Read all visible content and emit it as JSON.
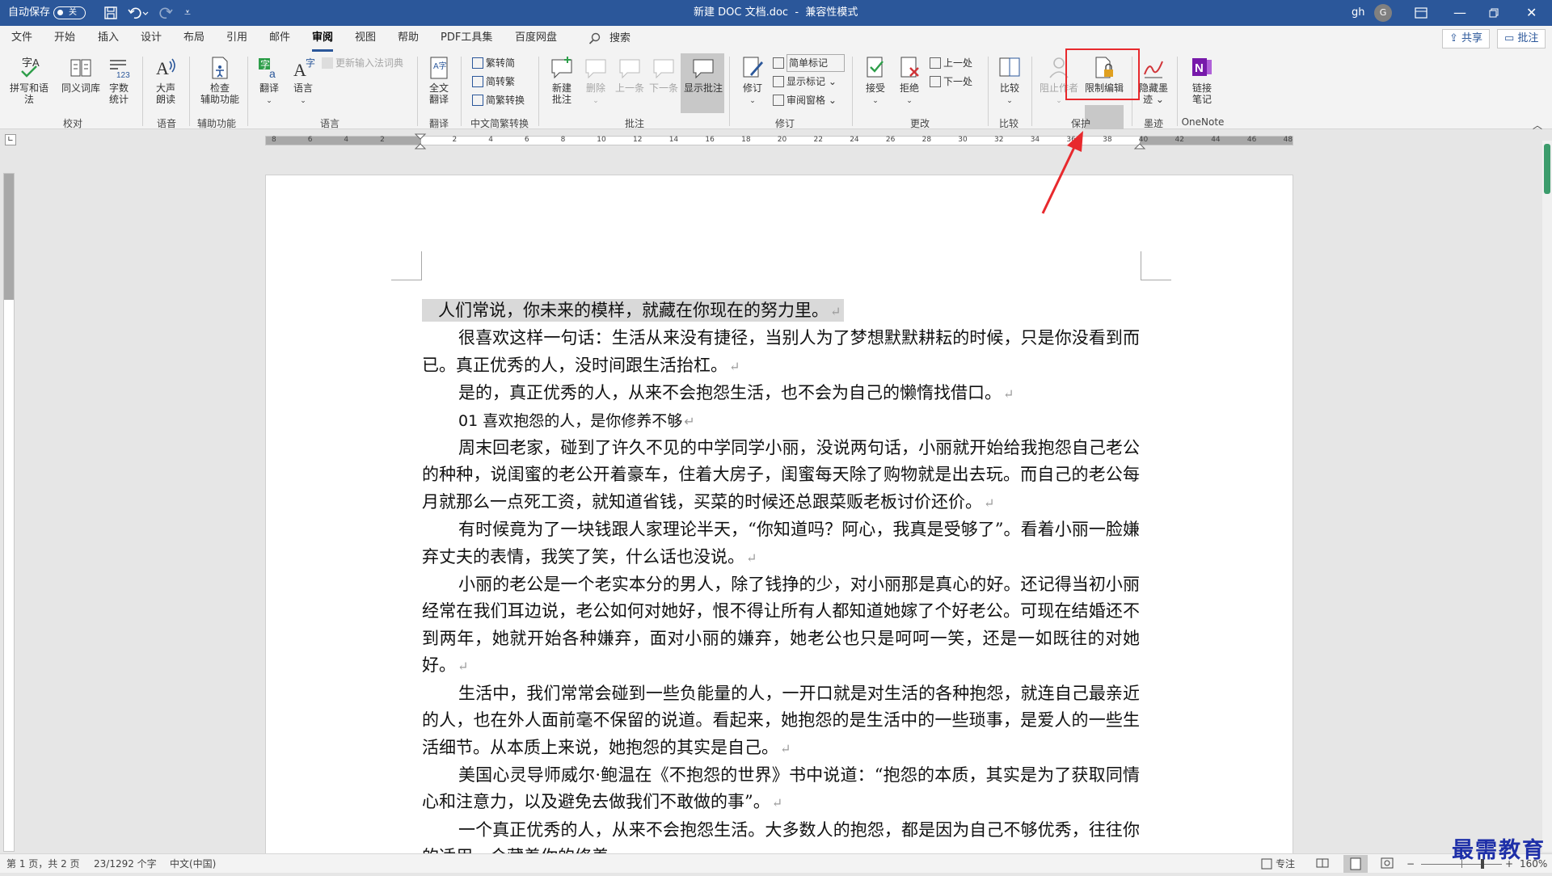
{
  "titlebar": {
    "autosave_label": "自动保存",
    "autosave_state": "关",
    "doc_title": "新建 DOC 文档.doc",
    "mode": "兼容性模式",
    "user": "gh",
    "avatar": "G"
  },
  "tabs": [
    {
      "label": "文件"
    },
    {
      "label": "开始"
    },
    {
      "label": "插入"
    },
    {
      "label": "设计"
    },
    {
      "label": "布局"
    },
    {
      "label": "引用"
    },
    {
      "label": "邮件"
    },
    {
      "label": "审阅"
    },
    {
      "label": "视图"
    },
    {
      "label": "帮助"
    },
    {
      "label": "PDF工具集"
    },
    {
      "label": "百度网盘"
    },
    {
      "label": "搜索"
    }
  ],
  "share_label": "共享",
  "comment_label": "批注",
  "ribbon": {
    "b1": "拼写和语法",
    "b2": "同义词库",
    "b3a": "字数",
    "b3b": "统计",
    "g1": "校对",
    "b4a": "大声",
    "b4b": "朗读",
    "g2": "语音",
    "b5a": "检查",
    "b5b": "辅助功能",
    "g3": "辅助功能",
    "b6": "翻译",
    "b7": "语言",
    "s1": "更新输入法词典",
    "g4": "语言",
    "b8a": "全文",
    "b8b": "翻译",
    "g5": "翻译",
    "s2": "繁转简",
    "s3": "简转繁",
    "s4": "简繁转换",
    "g6": "中文简繁转换",
    "b9a": "新建",
    "b9b": "批注",
    "b10": "删除",
    "b11": "上一条",
    "b12": "下一条",
    "b13": "显示批注",
    "g7": "批注",
    "b14": "修订",
    "s5": "简单标记",
    "s6": "显示标记",
    "s7": "审阅窗格",
    "g8": "修订",
    "b15": "接受",
    "b16": "拒绝",
    "s8": "上一处",
    "s9": "下一处",
    "g9": "更改",
    "b17": "比较",
    "g10": "比较",
    "b18": "阻止作者",
    "b19": "限制编辑",
    "g11": "保护",
    "b20a": "隐藏墨",
    "b20b": "迹",
    "g12": "墨迹",
    "b21a": "链接",
    "b21b": "笔记",
    "g13": "OneNote"
  },
  "ruler_numbers": [
    "8",
    "6",
    "4",
    "2",
    "",
    "2",
    "4",
    "6",
    "8",
    "10",
    "12",
    "14",
    "16",
    "18",
    "20",
    "22",
    "24",
    "26",
    "28",
    "30",
    "32",
    "34",
    "36",
    "38",
    "40",
    "42",
    "44",
    "46",
    "48"
  ],
  "document": {
    "paragraphs": [
      "人们常说，你未来的模样，就藏在你现在的努力里。",
      "很喜欢这样一句话：生活从来没有捷径，当别人为了梦想默默耕耘的时候，只是你没看到而已。真正优秀的人，没时间跟生活抬杠。",
      "是的，真正优秀的人，从来不会抱怨生活，也不会为自己的懒惰找借口。",
      "01  喜欢抱怨的人，是你修养不够",
      "周末回老家，碰到了许久不见的中学同学小丽，没说两句话，小丽就开始给我抱怨自己老公的种种，说闺蜜的老公开着豪车，住着大房子，闺蜜每天除了购物就是出去玩。而自己的老公每月就那么一点死工资，就知道省钱，买菜的时候还总跟菜贩老板讨价还价。",
      "有时候竟为了一块钱跟人家理论半天，“你知道吗？阿心，我真是受够了”。看着小丽一脸嫌弃丈夫的表情，我笑了笑，什么话也没说。",
      "小丽的老公是一个老实本分的男人，除了钱挣的少，对小丽那是真心的好。还记得当初小丽经常在我们耳边说，老公如何对她好，恨不得让所有人都知道她嫁了个好老公。可现在结婚还不到两年，她就开始各种嫌弃，面对小丽的嫌弃，她老公也只是呵呵一笑，还是一如既往的对她好。",
      "生活中，我们常常会碰到一些负能量的人，一开口就是对生活的各种抱怨，就连自己最亲近的人，也在外人面前毫不保留的说道。看起来，她抱怨的是生活中的一些琐事，是爱人的一些生活细节。从本质上来说，她抱怨的其实是自己。",
      "美国心灵导师威尔·鲍温在《不抱怨的世界》书中说道：“抱怨的本质，其实是为了获取同情心和注意力，以及避免去做我们不敢做的事”。",
      "一个真正优秀的人，从来不会抱怨生活。大多数人的抱怨，都是因为自己不够优秀，往往你的适用，合藏着你的修养。"
    ]
  },
  "status": {
    "page": "第 1 页，共 2 页",
    "words": "23/1292 个字",
    "lang": "中文(中国)",
    "focus": "专注",
    "zoom": "160%"
  },
  "watermark": "最需教育",
  "colors": {
    "accent": "#2b579a",
    "highlight_box": "#e8292d"
  }
}
